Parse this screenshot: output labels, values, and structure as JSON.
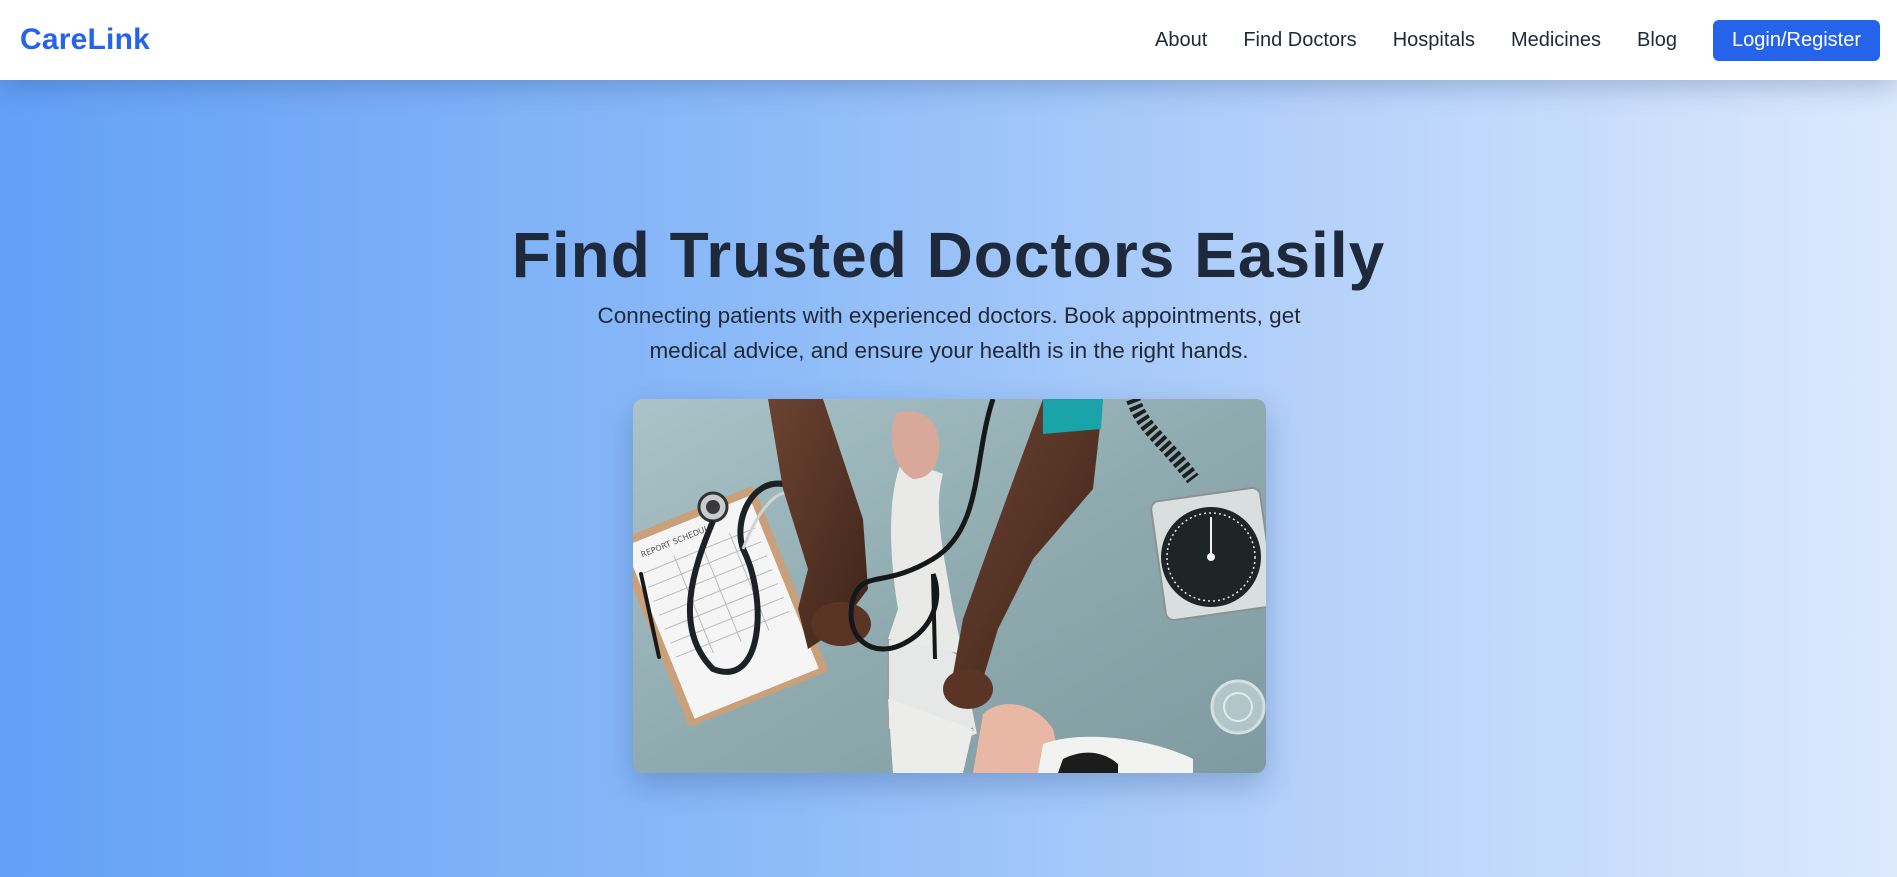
{
  "header": {
    "logo": "CareLink",
    "nav": [
      "About",
      "Find Doctors",
      "Hospitals",
      "Medicines",
      "Blog"
    ],
    "login_label": "Login/Register"
  },
  "hero": {
    "title": "Find Trusted Doctors Easily",
    "subtitle": "Connecting patients with experienced doctors. Book appointments, get medical advice, and ensure your health is in the right hands.",
    "image_clipboard_text": "REPORT SCHEDULE"
  },
  "colors": {
    "brand": "#2563eb",
    "heading": "#1e293b",
    "hero_gradient_start": "#63a0f6",
    "hero_gradient_end": "#dce9fd"
  }
}
